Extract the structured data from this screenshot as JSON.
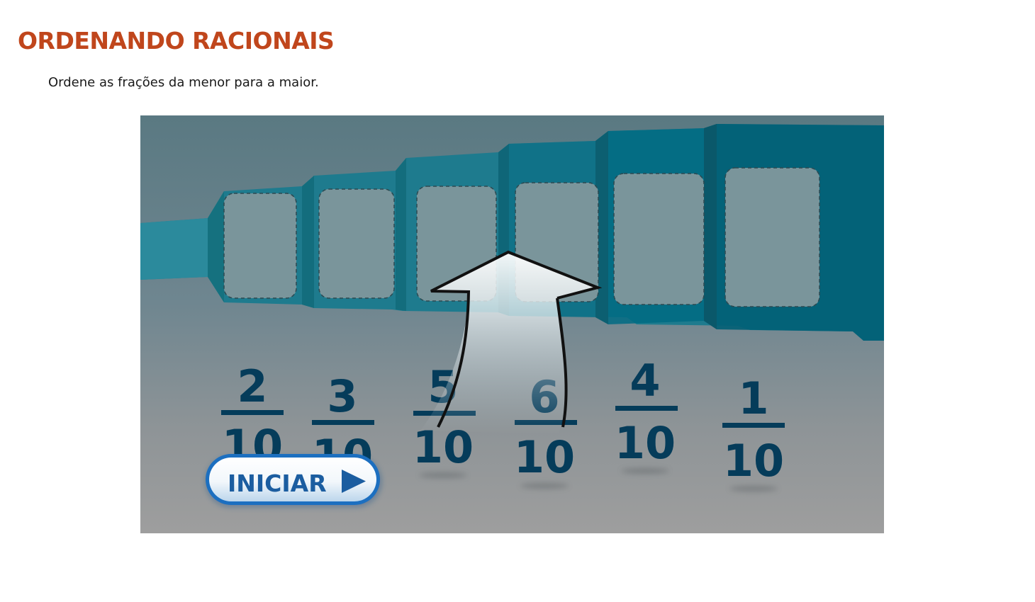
{
  "page": {
    "title": "ORDENANDO RACIONAIS",
    "instruction": "Ordene as frações da menor para a maior."
  },
  "game": {
    "start_button_label": "INICIAR",
    "slot_count": 6,
    "fractions": [
      {
        "numerator": "2",
        "denominator": "10"
      },
      {
        "numerator": "3",
        "denominator": "10"
      },
      {
        "numerator": "5",
        "denominator": "10"
      },
      {
        "numerator": "6",
        "denominator": "10"
      },
      {
        "numerator": "4",
        "denominator": "10"
      },
      {
        "numerator": "1",
        "denominator": "10"
      }
    ],
    "colors": {
      "title": "#c0461c",
      "track": "#1e7b8e",
      "track_dark": "#005f76",
      "slot": "#7a959b",
      "fraction": "#053c5a",
      "button_text": "#1b5da0"
    },
    "icons": {
      "hint_arrow": "up-arrow-icon",
      "play": "play-triangle-icon"
    }
  }
}
